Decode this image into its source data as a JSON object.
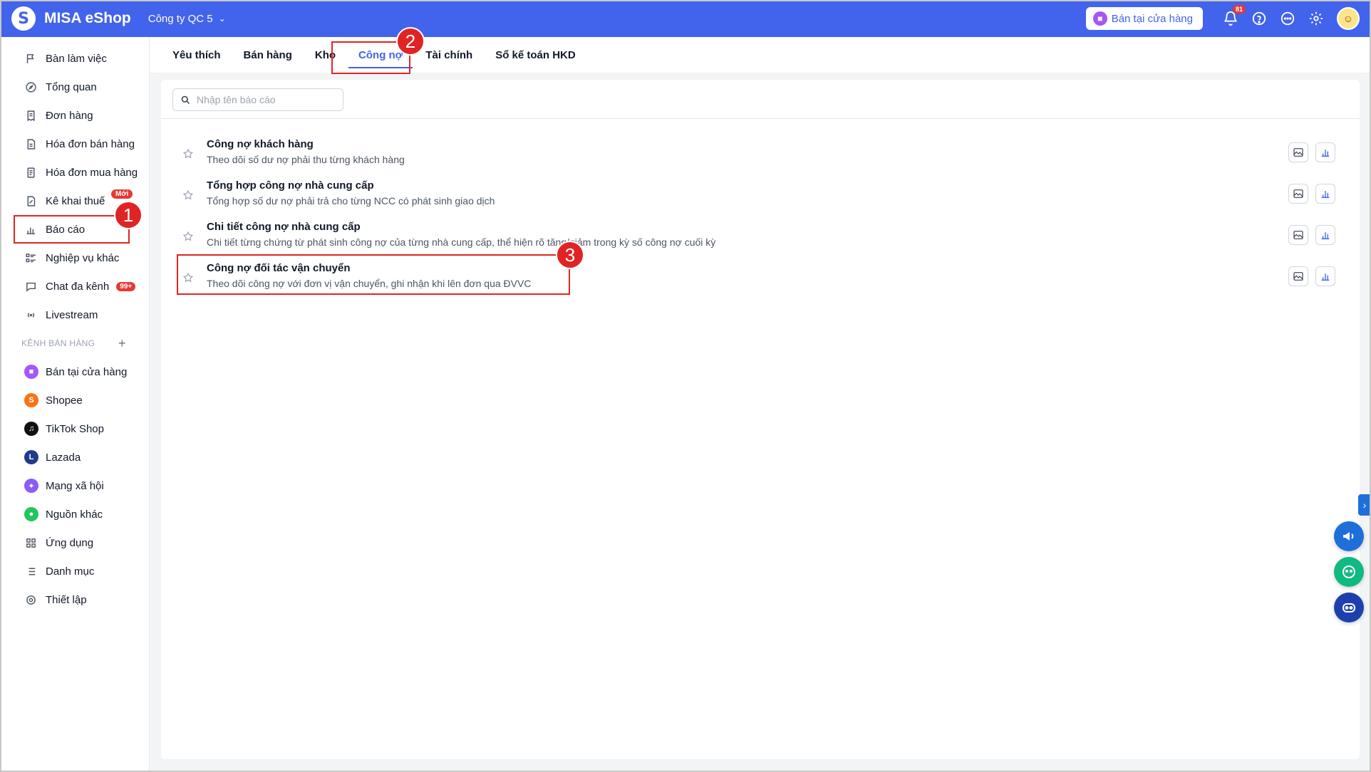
{
  "header": {
    "brand": "MISA eShop",
    "company": "Công ty QC 5",
    "store_button": "Bán tại cửa hàng",
    "notification_count": "81"
  },
  "sidebar": {
    "items": [
      {
        "label": "Bàn làm việc",
        "icon": "flag-icon"
      },
      {
        "label": "Tổng quan",
        "icon": "compass-icon"
      },
      {
        "label": "Đơn hàng",
        "icon": "order-icon"
      },
      {
        "label": "Hóa đơn bán hàng",
        "icon": "invoice-icon"
      },
      {
        "label": "Hóa đơn mua hàng",
        "icon": "receipt-icon"
      },
      {
        "label": "Kê khai thuế",
        "icon": "tax-icon",
        "badge": "Mới"
      },
      {
        "label": "Báo cáo",
        "icon": "chart-icon"
      },
      {
        "label": "Nghiệp vụ khác",
        "icon": "list-icon"
      },
      {
        "label": "Chat đa kênh",
        "icon": "chat-icon",
        "badge": "99+"
      },
      {
        "label": "Livestream",
        "icon": "broadcast-icon"
      }
    ],
    "section_title": "KÊNH BÁN HÀNG",
    "channels": [
      {
        "label": "Bán tại cửa hàng",
        "color": "#a855f7"
      },
      {
        "label": "Shopee",
        "color": "#f97316"
      },
      {
        "label": "TikTok Shop",
        "color": "#111111"
      },
      {
        "label": "Lazada",
        "color": "#1e3a8a"
      },
      {
        "label": "Mạng xã hội",
        "color": "#8b5cf6"
      },
      {
        "label": "Nguồn khác",
        "color": "#22c55e"
      }
    ],
    "bottom_items": [
      {
        "label": "Ứng dụng"
      },
      {
        "label": "Danh mục"
      },
      {
        "label": "Thiết lập"
      }
    ]
  },
  "tabs": [
    {
      "label": "Yêu thích"
    },
    {
      "label": "Bán hàng"
    },
    {
      "label": "Kho"
    },
    {
      "label": "Công nợ",
      "active": true
    },
    {
      "label": "Tài chính"
    },
    {
      "label": "Sổ kế toán HKD"
    }
  ],
  "search": {
    "placeholder": "Nhập tên báo cáo"
  },
  "reports": [
    {
      "title": "Công nợ khách hàng",
      "desc": "Theo dõi số dư nợ phải thu từng khách hàng"
    },
    {
      "title": "Tổng hợp công nợ nhà cung cấp",
      "desc": "Tổng hợp số dư nợ phải trả cho từng NCC có phát sinh giao dịch"
    },
    {
      "title": "Chi tiết công nợ nhà cung cấp",
      "desc": "Chi tiết từng chứng từ phát sinh công nợ của từng nhà cung cấp, thể hiện rõ tăng/giảm trong kỳ số công nợ cuối kỳ"
    },
    {
      "title": "Công nợ đối tác vận chuyển",
      "desc": "Theo dõi công nợ với đơn vị vận chuyển, ghi nhận khi lên đơn qua ĐVVC"
    }
  ],
  "annotations": [
    "1",
    "2",
    "3"
  ]
}
